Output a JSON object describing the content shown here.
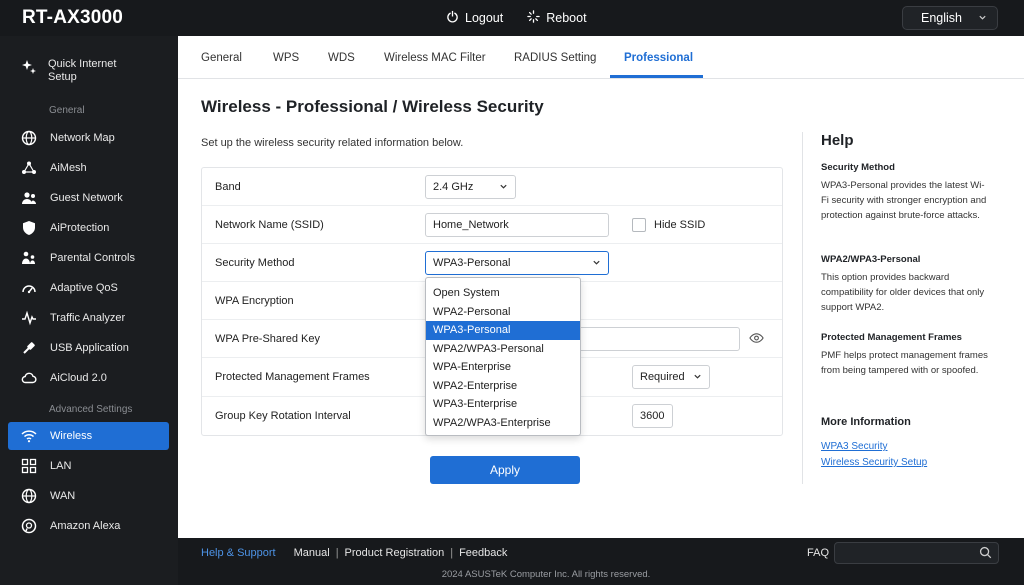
{
  "header": {
    "brand": "RT-AX3000",
    "logout_label": "Logout",
    "reboot_label": "Reboot",
    "language": "English"
  },
  "sidebar": {
    "quick_setup_label": "Quick Internet Setup",
    "section_general": "General",
    "section_advanced": "Advanced Settings",
    "items": [
      {
        "label": "Network Map",
        "icon": "globe-icon"
      },
      {
        "label": "AiMesh",
        "icon": "mesh-icon"
      },
      {
        "label": "Guest Network",
        "icon": "guest-network-icon"
      },
      {
        "label": "AiProtection",
        "icon": "shield-icon"
      },
      {
        "label": "Parental Controls",
        "icon": "family-icon"
      },
      {
        "label": "Adaptive QoS",
        "icon": "gauge-icon"
      },
      {
        "label": "Traffic Analyzer",
        "icon": "analyzer-icon"
      },
      {
        "label": "USB Application",
        "icon": "usb-icon"
      },
      {
        "label": "AiCloud 2.0",
        "icon": "cloud-icon"
      },
      {
        "label": "Wireless",
        "icon": "wifi-icon",
        "active": true
      },
      {
        "label": "LAN",
        "icon": "lan-icon"
      },
      {
        "label": "WAN",
        "icon": "globe-icon"
      },
      {
        "label": "Amazon Alexa",
        "icon": "alexa-icon"
      }
    ]
  },
  "tabs": [
    {
      "label": "General"
    },
    {
      "label": "WPS"
    },
    {
      "label": "WDS"
    },
    {
      "label": "Wireless MAC Filter"
    },
    {
      "label": "RADIUS Setting"
    },
    {
      "label": "Professional",
      "active": true
    }
  ],
  "page": {
    "title": "Wireless - Professional / Wireless Security",
    "subtitle": "Set up the wireless security related information below."
  },
  "form": {
    "band_label": "Band",
    "band_value": "2.4 GHz",
    "ssid_label": "Network Name (SSID)",
    "ssid_value": "Home_Network",
    "hide_ssid_label": "Hide SSID",
    "security_label": "Security Method",
    "security_value": "WPA3-Personal",
    "encryption_label": "WPA Encryption",
    "psk_label": "WPA Pre-Shared Key",
    "pmf_label": "Protected Management Frames",
    "pmf_value": "Required",
    "gkri_label": "Group Key Rotation Interval",
    "gkri_value": "3600",
    "security_options": [
      "Open System",
      "WPA2-Personal",
      "WPA3-Personal",
      "WPA2/WPA3-Personal",
      "WPA-Enterprise",
      "WPA2-Enterprise",
      "WPA3-Enterprise",
      "WPA2/WPA3-Enterprise"
    ],
    "selected_option_index": 2,
    "apply_label": "Apply"
  },
  "help": {
    "title": "Help",
    "sections": [
      {
        "heading": "Security Method",
        "body": "WPA3-Personal provides the latest Wi-Fi security with stronger encryption and protection against brute-force attacks."
      },
      {
        "heading": "WPA2/WPA3-Personal",
        "body": "This option provides backward compatibility for older devices that only support WPA2."
      },
      {
        "heading": "Protected Management Frames",
        "body": "PMF helps protect management frames from being tampered with or spoofed."
      }
    ],
    "more_info_heading": "More Information",
    "links": [
      "WPA3 Security",
      "Wireless Security Setup"
    ]
  },
  "footer": {
    "help_support": "Help & Support",
    "manual": "Manual",
    "product_registration": "Product Registration",
    "feedback": "Feedback",
    "separator": "|",
    "faq": "FAQ",
    "copyright": "2024 ASUSTeK Computer Inc. All rights reserved."
  },
  "colors": {
    "accent": "#1f6ed4",
    "sidebar_bg": "#1b1d20",
    "header_bg": "#17191c"
  }
}
